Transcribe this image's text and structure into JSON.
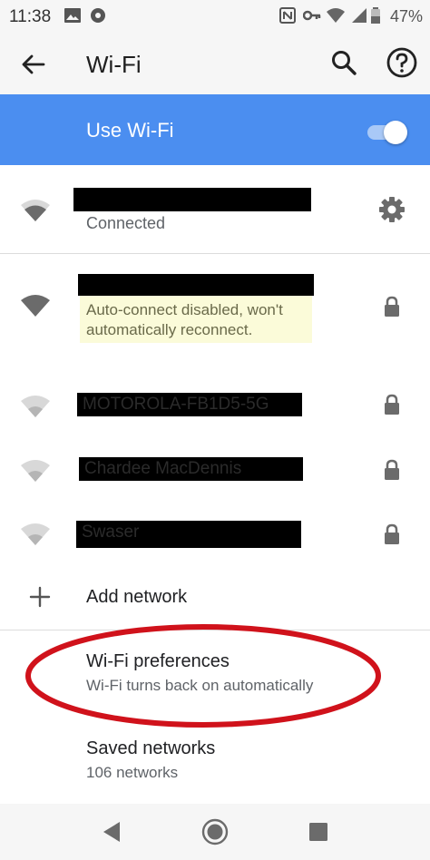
{
  "status_bar": {
    "time": "11:38",
    "battery": "47%",
    "icons": [
      "image-icon",
      "gear-badge-icon",
      "nfc-icon",
      "key-icon",
      "wifi-status-icon",
      "signal-icon",
      "battery-icon"
    ]
  },
  "app_bar": {
    "title": "Wi-Fi",
    "icons": [
      "back-arrow-icon",
      "search-icon",
      "help-icon"
    ]
  },
  "use_wifi": {
    "label": "Use Wi-Fi",
    "enabled": true,
    "accent_color": "#4b8ef0"
  },
  "networks": {
    "connected": {
      "name": "",
      "status": "Connected"
    },
    "saved_disabled": {
      "name": "",
      "note": "Auto-connect disabled, won't automatically reconnect."
    },
    "n1": {
      "name": "MOTOROLA-FB1D5-5G"
    },
    "n2": {
      "name": "Chardee MacDennis"
    },
    "n3": {
      "name": "Swaser"
    }
  },
  "add_network": {
    "label": "Add network"
  },
  "preferences": {
    "title": "Wi-Fi preferences",
    "subtitle": "Wi-Fi turns back on automatically",
    "highlight_color": "#d0121b"
  },
  "saved_networks": {
    "title": "Saved networks",
    "subtitle": "106 networks"
  }
}
